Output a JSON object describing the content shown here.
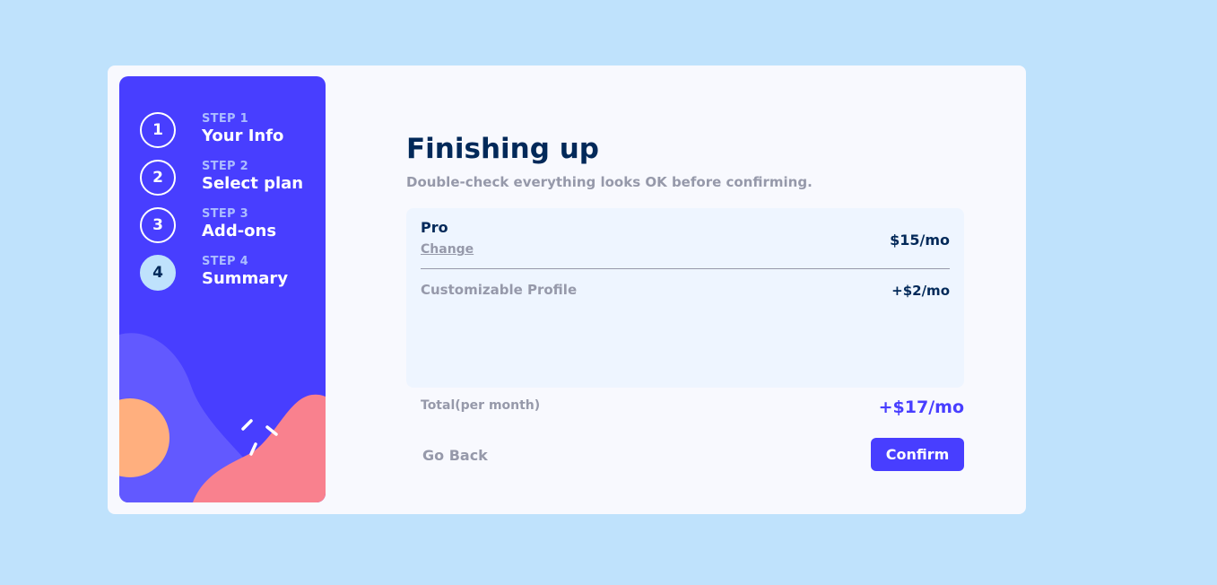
{
  "sidebar": {
    "steps": [
      {
        "number": "1",
        "caption": "STEP 1",
        "title": "Your Info",
        "active": false
      },
      {
        "number": "2",
        "caption": "STEP 2",
        "title": "Select plan",
        "active": false
      },
      {
        "number": "3",
        "caption": "STEP 3",
        "title": "Add-ons",
        "active": false
      },
      {
        "number": "4",
        "caption": "STEP 4",
        "title": "Summary",
        "active": true
      }
    ]
  },
  "main": {
    "title": "Finishing up",
    "subtitle": "Double-check everything looks OK before confirming.",
    "summary": {
      "plan_name": "Pro",
      "change_label": "Change",
      "plan_price": "$15/mo",
      "addons": [
        {
          "name": "Customizable Profile",
          "price": "+$2/mo"
        }
      ]
    },
    "total": {
      "label": "Total(per month)",
      "value": "+$17/mo"
    },
    "go_back_label": "Go Back",
    "confirm_label": "Confirm"
  },
  "colors": {
    "page_background": "#bfe2fc",
    "sidebar": "#483eff",
    "accent": "#483eff",
    "heading": "#022959",
    "muted": "#9699aa",
    "active_step": "#bfe2fc"
  }
}
